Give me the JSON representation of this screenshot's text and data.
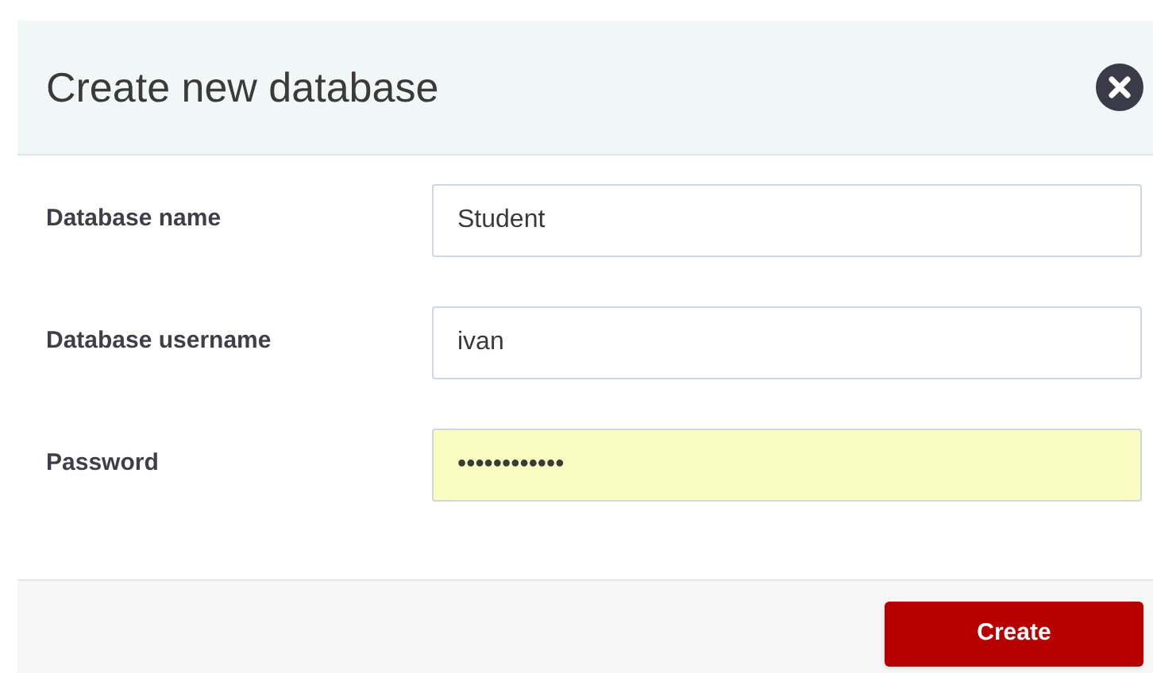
{
  "dialog": {
    "title": "Create new database"
  },
  "fields": [
    {
      "label": "Database name",
      "value": "Student",
      "autofilled": false
    },
    {
      "label": "Database username",
      "value": "ivan",
      "autofilled": false
    },
    {
      "label": "Password",
      "value": "••••••••••••",
      "autofilled": true
    }
  ],
  "buttons": [
    {
      "label": "Create"
    }
  ]
}
